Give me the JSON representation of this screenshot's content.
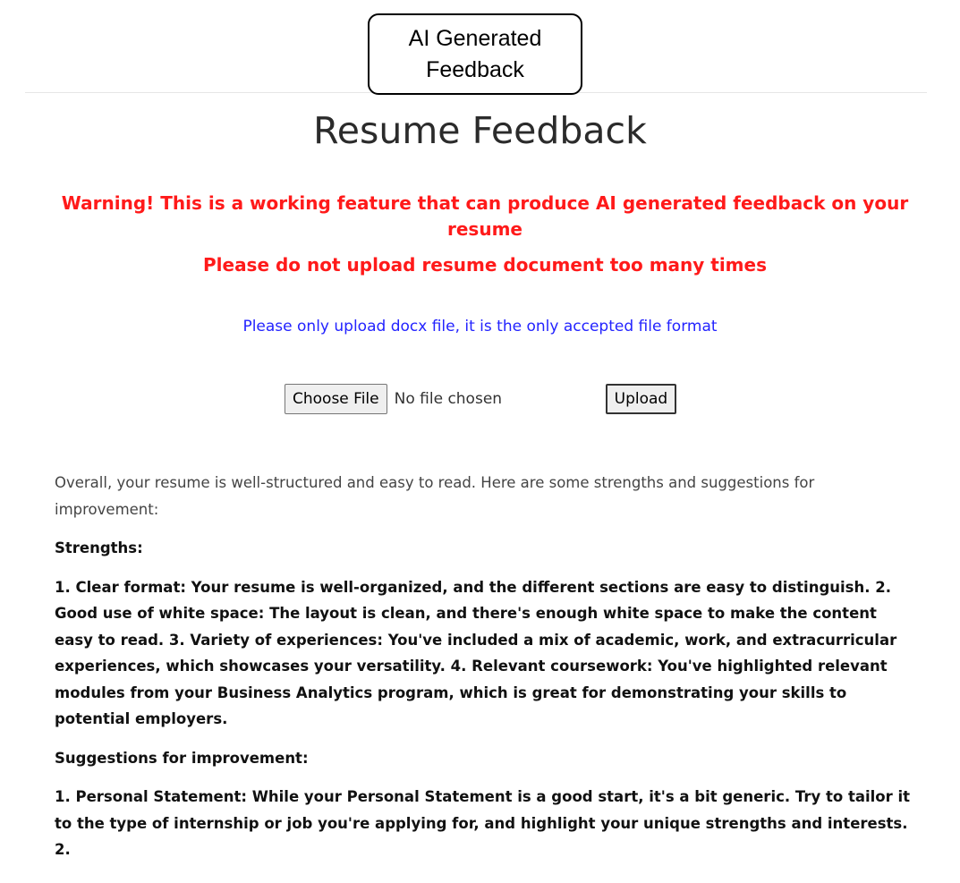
{
  "callout": {
    "line1": "AI Generated",
    "line2": "Feedback"
  },
  "page": {
    "title": "Resume Feedback",
    "warning_line1": "Warning! This is a working feature that can produce AI generated feedback on your resume",
    "warning_line2": "Please do not upload resume document too many times",
    "format_note": "Please only upload docx file, it is the only accepted file format"
  },
  "upload": {
    "choose_label": "Choose File",
    "file_status": "No file chosen",
    "upload_label": "Upload"
  },
  "feedback": {
    "intro": "Overall, your resume is well-structured and easy to read. Here are some strengths and suggestions for improvement:",
    "strengths_heading": "Strengths:",
    "strengths_body": "1. Clear format: Your resume is well-organized, and the different sections are easy to distinguish. 2. Good use of white space: The layout is clean, and there's enough white space to make the content easy to read. 3. Variety of experiences: You've included a mix of academic, work, and extracurricular experiences, which showcases your versatility. 4. Relevant coursework: You've highlighted relevant modules from your Business Analytics program, which is great for demonstrating your skills to potential employers.",
    "suggestions_heading": "Suggestions for improvement:",
    "suggestions_body": "1. Personal Statement: While your Personal Statement is a good start, it's a bit generic. Try to tailor it to the type of internship or job you're applying for, and highlight your unique strengths and interests. 2."
  },
  "colors": {
    "warning": "#ff1a1a",
    "format_note": "#2323ff",
    "title": "#2b2b2b"
  }
}
